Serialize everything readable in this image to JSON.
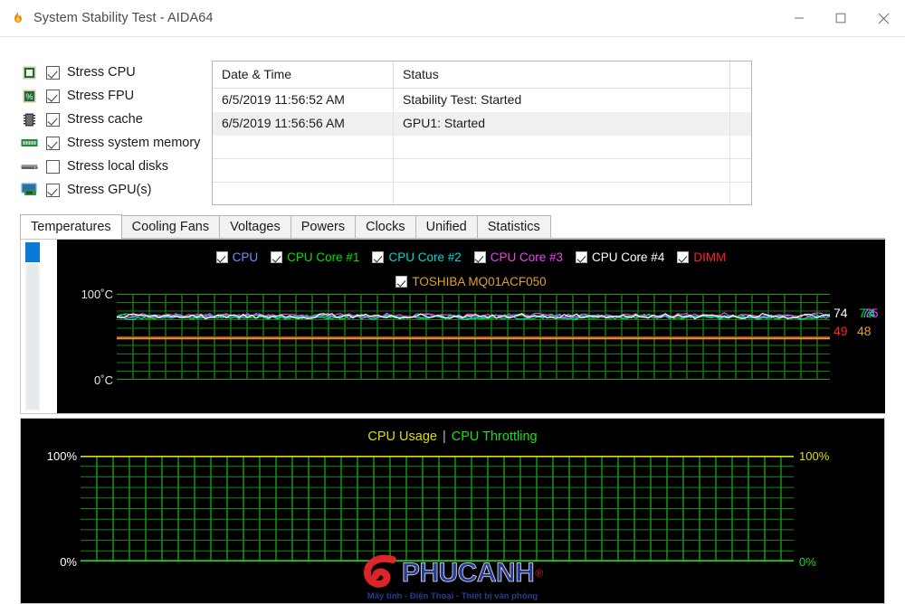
{
  "window": {
    "title": "System Stability Test - AIDA64",
    "icon": "aida64-flame-icon",
    "minimize_label": "Minimize",
    "maximize_label": "Maximize",
    "close_label": "Close"
  },
  "stress_options": [
    {
      "label": "Stress CPU",
      "checked": true,
      "icon": "cpu-chip-icon"
    },
    {
      "label": "Stress FPU",
      "checked": true,
      "icon": "fpu-percent-chip-icon"
    },
    {
      "label": "Stress cache",
      "checked": true,
      "icon": "cache-module-icon"
    },
    {
      "label": "Stress system memory",
      "checked": true,
      "icon": "memory-dimm-icon"
    },
    {
      "label": "Stress local disks",
      "checked": false,
      "icon": "hard-disk-icon"
    },
    {
      "label": "Stress GPU(s)",
      "checked": true,
      "icon": "gpu-monitor-icon"
    }
  ],
  "status_grid": {
    "columns": [
      "Date & Time",
      "Status",
      ""
    ],
    "rows": [
      {
        "datetime": "6/5/2019 11:56:52 AM",
        "status": "Stability Test: Started"
      },
      {
        "datetime": "6/5/2019 11:56:56 AM",
        "status": "GPU1: Started"
      }
    ],
    "empty_rows": 3
  },
  "tabs": [
    {
      "label": "Temperatures",
      "active": true
    },
    {
      "label": "Cooling Fans",
      "active": false
    },
    {
      "label": "Voltages",
      "active": false
    },
    {
      "label": "Powers",
      "active": false
    },
    {
      "label": "Clocks",
      "active": false
    },
    {
      "label": "Unified",
      "active": false
    },
    {
      "label": "Statistics",
      "active": false
    }
  ],
  "temperature_panel": {
    "legend_row1": [
      {
        "label": "CPU",
        "color": "#6f8fff",
        "checked": true
      },
      {
        "label": "CPU Core #1",
        "color": "#00e000",
        "checked": true
      },
      {
        "label": "CPU Core #2",
        "color": "#00d8d8",
        "checked": true
      },
      {
        "label": "CPU Core #3",
        "color": "#ee44ee",
        "checked": true
      },
      {
        "label": "CPU Core #4",
        "color": "#ffffff",
        "checked": true
      },
      {
        "label": "DIMM",
        "color": "#ff2020",
        "checked": true
      }
    ],
    "legend_row2": [
      {
        "label": "TOSHIBA MQ01ACF050",
        "color": "#e0a030",
        "checked": true
      }
    ],
    "axis_top": "100˚C",
    "axis_bottom": "0˚C",
    "current_values": [
      {
        "value": "74",
        "color": "#ffffff"
      },
      {
        "value": "73",
        "color": "#00e000"
      },
      {
        "value": "74",
        "color": "#00d8d8"
      },
      {
        "value": "75",
        "color": "#ee44ee"
      },
      {
        "value": "49",
        "color": "#ff2020"
      },
      {
        "value": "48",
        "color": "#e0a030"
      }
    ],
    "scrollbar_position": "top"
  },
  "cpu_panel": {
    "title_usage": "CPU Usage",
    "title_separator": "|",
    "title_throttling": "CPU Throttling",
    "left_top": "100%",
    "left_bottom": "0%",
    "right_top": "100%",
    "right_bottom": "0%"
  },
  "watermark": {
    "brand": "PHUCANH",
    "registered": "®",
    "tagline": "Máy tính - Điện Thoại - Thiết bị văn phòng"
  },
  "chart_data": [
    {
      "type": "line",
      "title": "Temperatures",
      "ylabel": "˚C",
      "ylim": [
        0,
        100
      ],
      "grid": true,
      "legend_position": "top",
      "series": [
        {
          "name": "CPU",
          "color": "#6f8fff",
          "current": 74,
          "mean": 74,
          "min": 72,
          "max": 77
        },
        {
          "name": "CPU Core #1",
          "color": "#00e000",
          "current": 73,
          "mean": 73,
          "min": 71,
          "max": 76
        },
        {
          "name": "CPU Core #2",
          "color": "#00d8d8",
          "current": 74,
          "mean": 73,
          "min": 71,
          "max": 76
        },
        {
          "name": "CPU Core #3",
          "color": "#ee44ee",
          "current": 75,
          "mean": 75,
          "min": 73,
          "max": 78
        },
        {
          "name": "CPU Core #4",
          "color": "#ffffff",
          "current": 74,
          "mean": 74,
          "min": 72,
          "max": 77
        },
        {
          "name": "DIMM",
          "color": "#ff2020",
          "current": 49,
          "mean": 49,
          "min": 49,
          "max": 49
        },
        {
          "name": "TOSHIBA MQ01ACF050",
          "color": "#e0a030",
          "current": 48,
          "mean": 48,
          "min": 48,
          "max": 48
        }
      ]
    },
    {
      "type": "line",
      "title": "CPU Usage | CPU Throttling",
      "ylabel": "%",
      "ylim": [
        0,
        100
      ],
      "grid": true,
      "legend_position": "top",
      "series": [
        {
          "name": "CPU Usage",
          "color": "#dede00",
          "current": 100,
          "mean": 100,
          "min": 100,
          "max": 100
        },
        {
          "name": "CPU Throttling",
          "color": "#18e018",
          "current": 0,
          "mean": 0,
          "min": 0,
          "max": 0
        }
      ]
    }
  ]
}
